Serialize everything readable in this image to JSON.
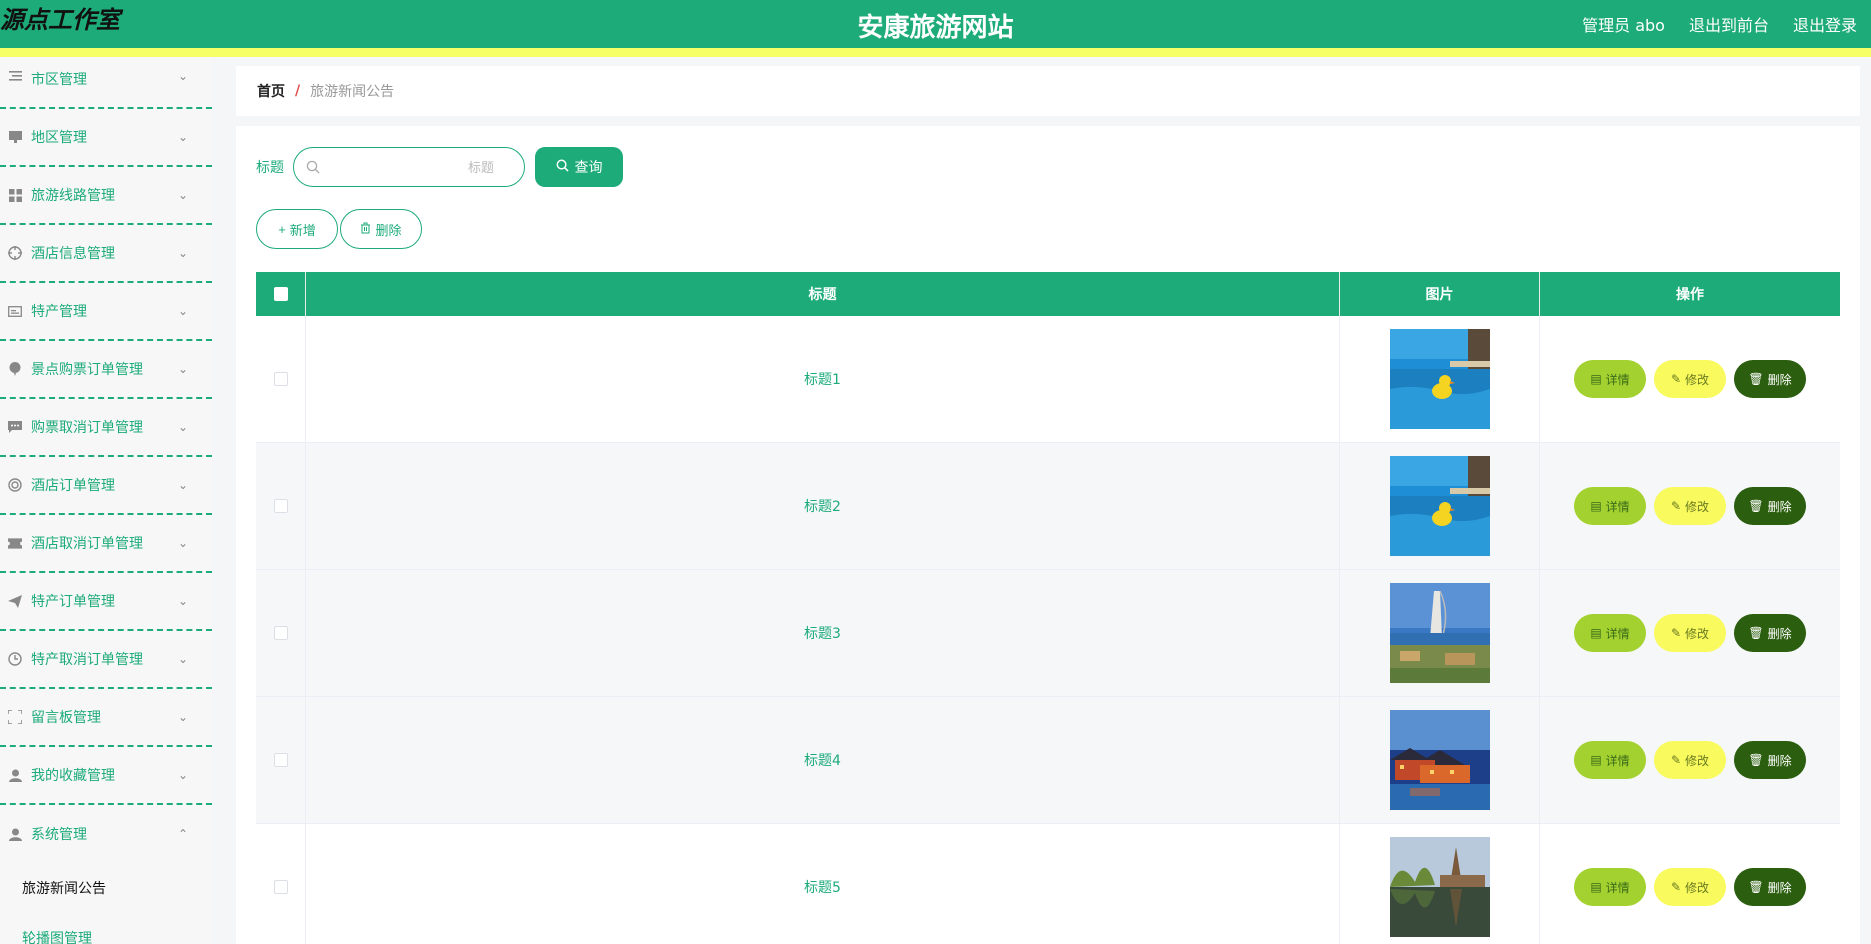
{
  "header": {
    "brand": "源点工作室",
    "site_title": "安康旅游网站",
    "user_label": "管理员 abo",
    "to_front_label": "退出到前台",
    "logout_label": "退出登录"
  },
  "sidebar": {
    "items": [
      {
        "label": "市区管理",
        "icon": "list-icon"
      },
      {
        "label": "地区管理",
        "icon": "monitor-icon"
      },
      {
        "label": "旅游线路管理",
        "icon": "grid-icon"
      },
      {
        "label": "酒店信息管理",
        "icon": "target-icon"
      },
      {
        "label": "特产管理",
        "icon": "card-icon"
      },
      {
        "label": "景点购票订单管理",
        "icon": "balloon-icon"
      },
      {
        "label": "购票取消订单管理",
        "icon": "chat-icon"
      },
      {
        "label": "酒店订单管理",
        "icon": "ring-icon"
      },
      {
        "label": "酒店取消订单管理",
        "icon": "ticket-icon"
      },
      {
        "label": "特产订单管理",
        "icon": "send-icon"
      },
      {
        "label": "特产取消订单管理",
        "icon": "clock-icon"
      },
      {
        "label": "留言板管理",
        "icon": "frame-icon"
      },
      {
        "label": "我的收藏管理",
        "icon": "user-icon"
      },
      {
        "label": "系统管理",
        "icon": "user-icon"
      }
    ],
    "sub_items": [
      {
        "label": "旅游新闻公告"
      },
      {
        "label": "轮播图管理"
      }
    ]
  },
  "breadcrumb": {
    "home": "首页",
    "separator": "/",
    "current": "旅游新闻公告"
  },
  "search": {
    "label": "标题",
    "placeholder": "标题",
    "value": "",
    "button_label": "查询"
  },
  "actions": {
    "add_label": "新增",
    "delete_label": "删除"
  },
  "table": {
    "headers": {
      "title": "标题",
      "image": "图片",
      "ops": "操作"
    },
    "rows": [
      {
        "title": "标题1",
        "image": "pool-duck"
      },
      {
        "title": "标题2",
        "image": "pool-duck"
      },
      {
        "title": "标题3",
        "image": "burj-resort"
      },
      {
        "title": "标题4",
        "image": "night-village"
      },
      {
        "title": "标题5",
        "image": "lake-temple"
      }
    ],
    "op_labels": {
      "detail": "详情",
      "edit": "修改",
      "delete": "删除"
    }
  },
  "colors": {
    "primary": "#1dab7a",
    "accent_strip": "#f7ff66",
    "detail": "#a3d12f",
    "edit": "#f8fa5e",
    "delete": "#2b5e0e"
  }
}
